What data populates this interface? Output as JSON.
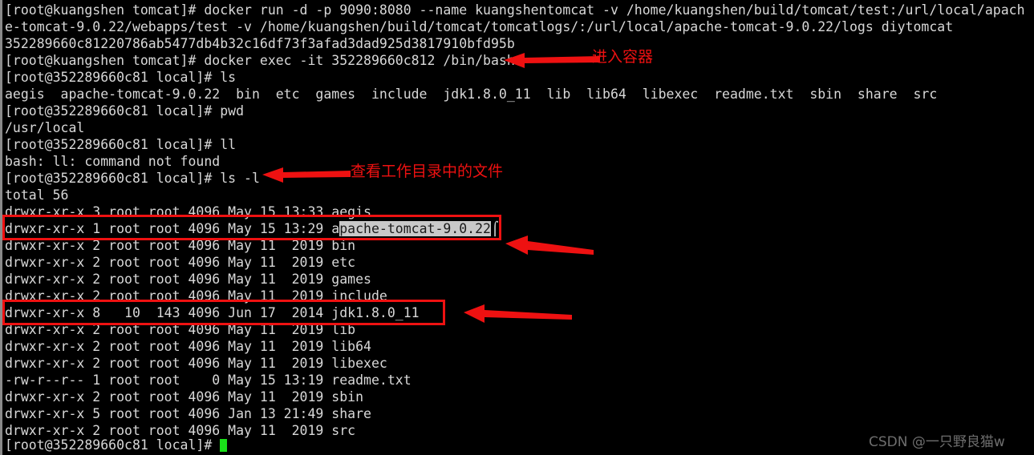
{
  "terminal": {
    "background_color": "#000000",
    "foreground_color": "#d8d8d8",
    "cursor_color": "#19e019",
    "selection_bg": "#c9c9c9",
    "annotation_color": "#ee1111",
    "lines": [
      "[root@kuangshen tomcat]# docker run -d -p 9090:8080 --name kuangshentomcat -v /home/kuangshen/build/tomcat/test:/url/local/apach",
      "e-tomcat-9.0.22/webapps/test -v /home/kuangshen/build/tomcat/tomcatlogs/:/url/local/apache-tomcat-9.0.22/logs diytomcat",
      "352289660c81220786ab5477db4b32c16df73f3afad3dad925d3817910bfd95b",
      "[root@kuangshen tomcat]# docker exec -it 352289660c812 /bin/bash",
      "[root@352289660c81 local]# ls",
      "aegis  apache-tomcat-9.0.22  bin  etc  games  include  jdk1.8.0_11  lib  lib64  libexec  readme.txt  sbin  share  src",
      "[root@352289660c81 local]# pwd",
      "/usr/local",
      "[root@352289660c81 local]# ll",
      "bash: ll: command not found",
      "[root@352289660c81 local]# ls -l",
      "total 56",
      "drwxr-xr-x 3 root root 4096 May 15 13:33 aegis",
      "drwxr-xr-x 1 root root 4096 May 15 13:29 a",
      "drwxr-xr-x 2 root root 4096 May 11  2019 bin",
      "drwxr-xr-x 2 root root 4096 May 11  2019 etc",
      "drwxr-xr-x 2 root root 4096 May 11  2019 games",
      "drwxr-xr-x 2 root root 4096 May 11  2019 include",
      "drwxr-xr-x 8   10  143 4096 Jun 17  2014 jdk1.8.0_11",
      "drwxr-xr-x 2 root root 4096 May 11  2019 lib",
      "drwxr-xr-x 2 root root 4096 May 11  2019 lib64",
      "drwxr-xr-x 2 root root 4096 May 11  2019 libexec",
      "-rw-r--r-- 1 root root    0 May 15 13:19 readme.txt",
      "drwxr-xr-x 2 root root 4096 May 11  2019 sbin",
      "drwxr-xr-x 5 root root 4096 Jan 13 21:49 share",
      "drwxr-xr-x 2 root root 4096 May 11  2019 src",
      "[root@352289660c81 local]# "
    ],
    "selected_text": "pache-tomcat-9.0.22",
    "final_prompt": "[root@352289660c81 local]# "
  },
  "annotations": {
    "enter_container": "进入容器",
    "list_working_dir_files": "查看工作目录中的文件"
  },
  "watermark": "CSDN @一只野良猫w"
}
